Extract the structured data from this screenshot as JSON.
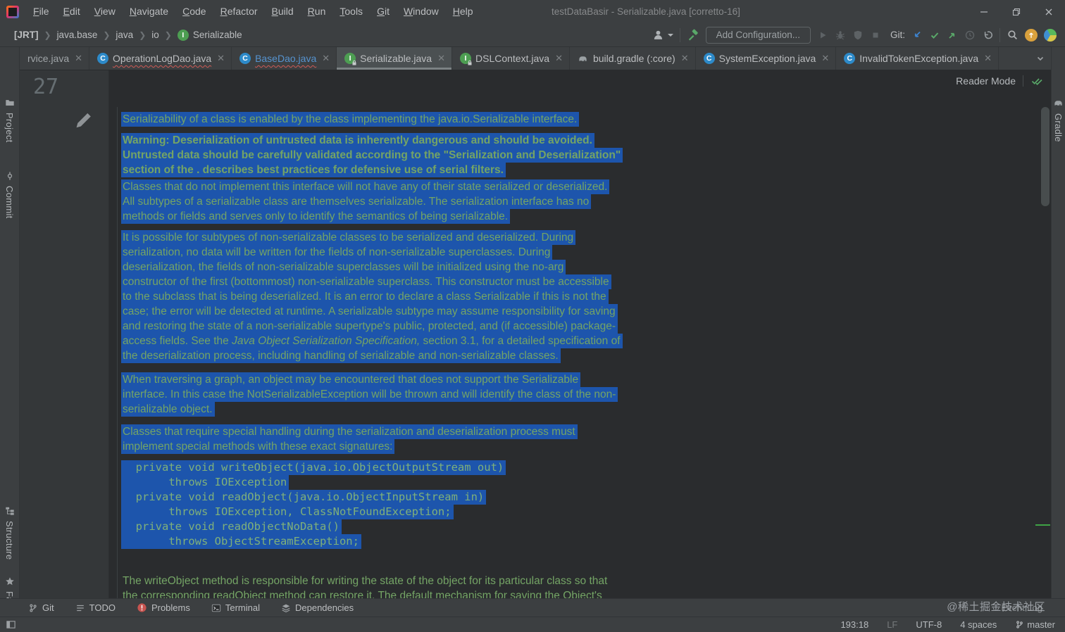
{
  "title_bar": {
    "title": "testDataBasir - Serializable.java [corretto-16]",
    "menu_items": [
      "File",
      "Edit",
      "View",
      "Navigate",
      "Code",
      "Refactor",
      "Build",
      "Run",
      "Tools",
      "Git",
      "Window",
      "Help"
    ]
  },
  "nav_bar": {
    "breadcrumbs": [
      "[JRT]",
      "java.base",
      "java",
      "io",
      "Serializable"
    ],
    "add_configuration_label": "Add Configuration...",
    "git_label": "Git:"
  },
  "tab_bar": {
    "tabs": [
      {
        "label": "rvice.java",
        "icon": "none",
        "icon_letter": ""
      },
      {
        "label": "OperationLogDao.java",
        "icon": "class",
        "icon_letter": "C"
      },
      {
        "label": "BaseDao.java",
        "icon": "class",
        "icon_letter": "C"
      },
      {
        "label": "Serializable.java",
        "icon": "interface-lock",
        "icon_letter": "I"
      },
      {
        "label": "DSLContext.java",
        "icon": "interface-lock",
        "icon_letter": "I"
      },
      {
        "label": "build.gradle (:core)",
        "icon": "gradle",
        "icon_letter": ""
      },
      {
        "label": "SystemException.java",
        "icon": "class",
        "icon_letter": "C"
      },
      {
        "label": "InvalidTokenException.java",
        "icon": "class",
        "icon_letter": "C"
      }
    ]
  },
  "left_stripe": {
    "items": [
      {
        "label": "Project",
        "icon": "folder-icon"
      },
      {
        "label": "Commit",
        "icon": "commit-icon"
      },
      {
        "label": "Structure",
        "icon": "structure-icon"
      },
      {
        "label": "Favorites",
        "icon": "star-icon"
      }
    ]
  },
  "right_stripe": {
    "items": [
      {
        "label": "Gradle",
        "icon": "gradle-icon"
      }
    ]
  },
  "editor": {
    "line_number": "27",
    "reader_mode_label": "Reader Mode",
    "paragraphs": [
      {
        "style": "normal",
        "selected": true,
        "lines": [
          "Serializability of a class is enabled by the class implementing the java.io.Serializable interface."
        ]
      },
      {
        "style": "bold",
        "selected": true,
        "lines": [
          "Warning: Deserialization of untrusted data is inherently dangerous and should be avoided.",
          "Untrusted data should be carefully validated according to the \"Serialization and Deserialization\"",
          "section of the . describes best practices for defensive use of serial filters."
        ]
      },
      {
        "style": "normal",
        "selected": true,
        "lines": [
          "Classes that do not implement this interface will not have any of their state serialized or deserialized.",
          "All subtypes of a serializable class are themselves serializable. The serialization interface has no",
          "methods or fields and serves only to identify the semantics of being serializable."
        ]
      },
      {
        "style": "normal",
        "selected": true,
        "lines": [
          "It is possible for subtypes of non-serializable classes to be serialized and deserialized. During",
          "serialization, no data will be written for the fields of non-serializable superclasses. During",
          "deserialization, the fields of non-serializable superclasses will be initialized using the no-arg",
          "constructor of the first (bottommost) non-serializable superclass. This constructor must be accessible",
          "to the subclass that is being deserialized. It is an error to declare a class Serializable if this is not the",
          "case; the error will be detected at runtime. A serializable subtype may assume responsibility for saving",
          "and restoring the state of a non-serializable supertype's public, protected, and (if accessible) package-",
          [
            {
              "t": "access fields. See the "
            },
            {
              "t": "Java Object Serialization Specification,",
              "i": true
            },
            {
              "t": " section 3.1, for a detailed specification of"
            }
          ],
          "the deserialization process, including handling of serializable and non-serializable classes."
        ]
      },
      {
        "style": "normal",
        "selected": true,
        "lines": [
          "When traversing a graph, an object may be encountered that does not support the Serializable",
          "interface. In this case the NotSerializableException will be thrown and will identify the class of the non-",
          "serializable object."
        ]
      },
      {
        "style": "normal",
        "selected": true,
        "lines": [
          "Classes that require special handling during the serialization and deserialization process must",
          "implement special methods with these exact signatures:"
        ]
      },
      {
        "style": "code",
        "selected": true,
        "lines": [
          "  private void writeObject(java.io.ObjectOutputStream out)",
          "       throws IOException",
          "  private void readObject(java.io.ObjectInputStream in)",
          "       throws IOException, ClassNotFoundException;",
          "  private void readObjectNoData()",
          "       throws ObjectStreamException;"
        ]
      },
      {
        "style": "normal",
        "selected": false,
        "lines": [
          "The writeObject method is responsible for writing the state of the object for its particular class so that",
          "the corresponding readObject method can restore it. The default mechanism for saving the Object's"
        ]
      }
    ]
  },
  "bottom_bar": {
    "items": [
      {
        "label": "Git",
        "icon": "git-branch-icon"
      },
      {
        "label": "TODO",
        "icon": "todo-icon"
      },
      {
        "label": "Problems",
        "icon": "problems-icon"
      },
      {
        "label": "Terminal",
        "icon": "terminal-icon"
      },
      {
        "label": "Dependencies",
        "icon": "dependencies-icon"
      }
    ],
    "event_log_label": "Event Log",
    "watermark": "@稀土掘金技术社区"
  },
  "status_bar": {
    "caret_position": "193:18",
    "line_separator": "LF",
    "encoding": "UTF-8",
    "indent": "4 spaces",
    "branch": "master"
  },
  "colors": {
    "selection_blue": "#1d55ac",
    "doc_text_green": "#74a465",
    "code_text_green": "#7fb07a",
    "chrome": "#3c3f41",
    "editor_bg": "#2a2c2e",
    "error_red": "#c75450",
    "vcs_green": "#3fa345",
    "git_update_blue": "#3d84d0",
    "git_commit_green": "#59a869"
  }
}
